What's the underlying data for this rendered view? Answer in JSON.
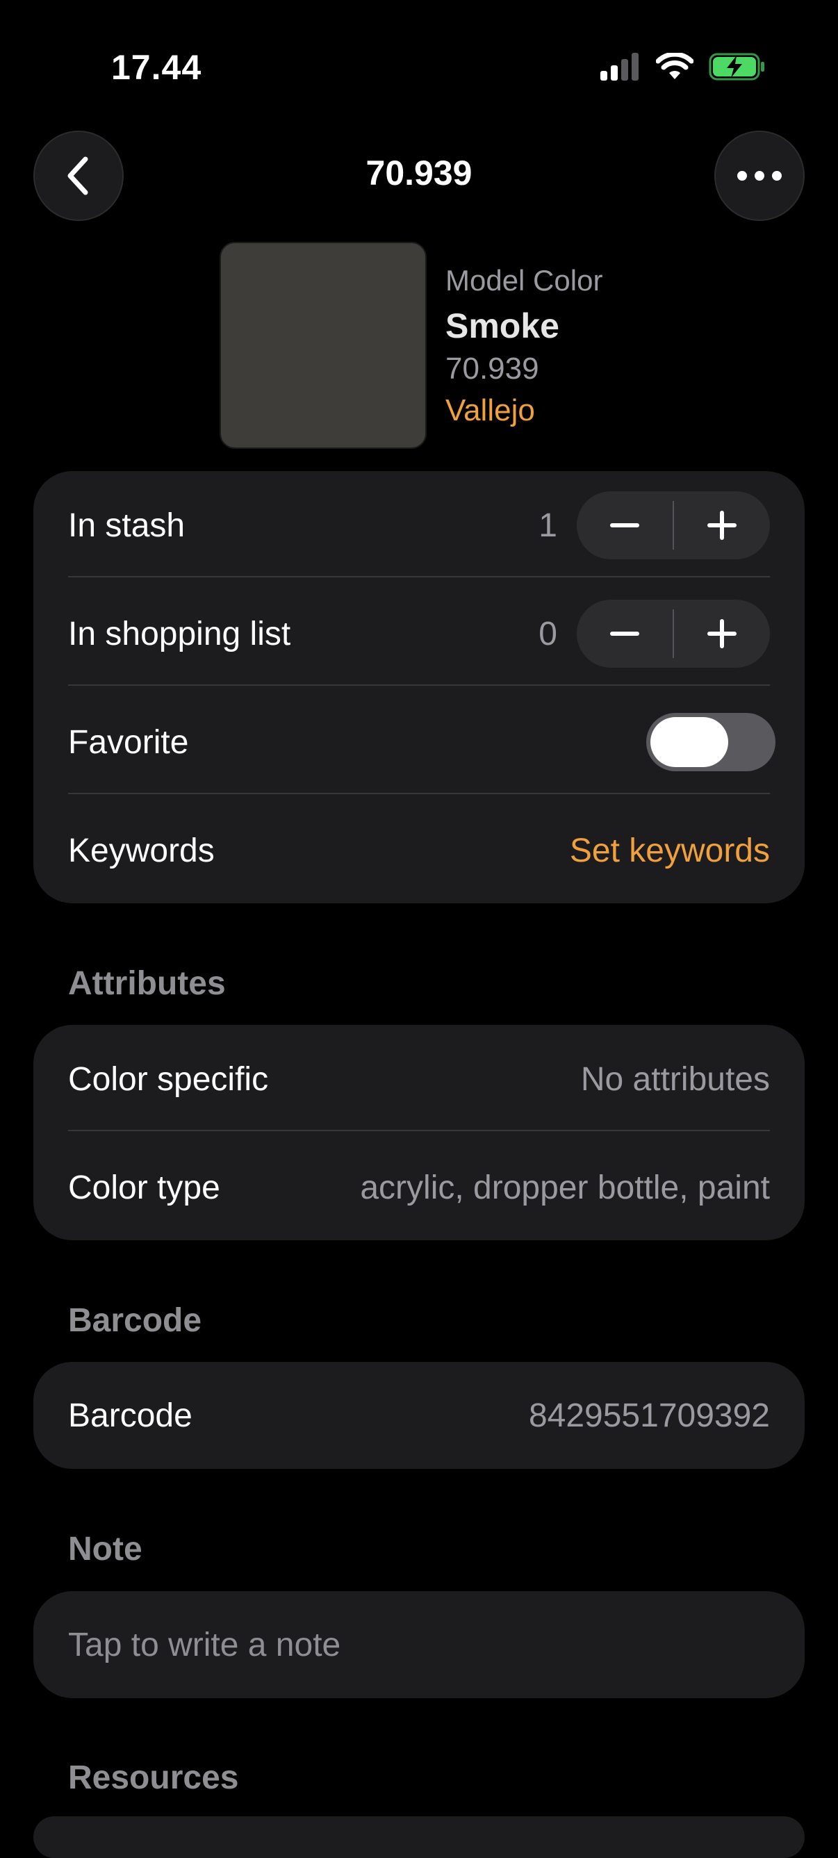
{
  "status_bar": {
    "time": "17.44"
  },
  "nav": {
    "title": "70.939"
  },
  "paint": {
    "brand_line": "Model Color",
    "name": "Smoke",
    "code": "70.939",
    "manufacturer": "Vallejo",
    "swatch_color": "#3e3d39"
  },
  "inventory": {
    "stash_label": "In stash",
    "stash_count": "1",
    "shopping_label": "In shopping list",
    "shopping_count": "0",
    "favorite_label": "Favorite",
    "favorite_on": false,
    "keywords_label": "Keywords",
    "keywords_action": "Set keywords"
  },
  "attributes": {
    "heading": "Attributes",
    "color_specific_label": "Color specific",
    "color_specific_value": "No attributes",
    "color_type_label": "Color type",
    "color_type_value": "acrylic, dropper bottle, paint"
  },
  "barcode": {
    "heading": "Barcode",
    "label": "Barcode",
    "value": "8429551709392"
  },
  "note": {
    "heading": "Note",
    "placeholder": "Tap to write a note"
  },
  "resources": {
    "heading": "Resources"
  },
  "colors": {
    "accent": "#f0a03c",
    "card": "#1c1c1e",
    "battery": "#4cd964"
  }
}
